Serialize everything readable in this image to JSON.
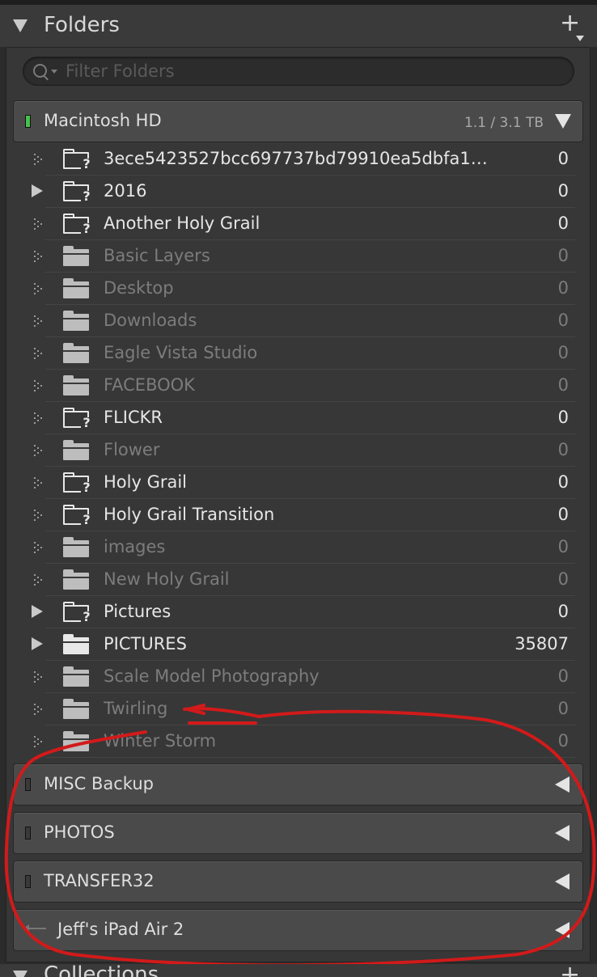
{
  "header": {
    "title": "Folders",
    "add_label": "+"
  },
  "search": {
    "placeholder": "Filter Folders"
  },
  "volumes": [
    {
      "name": "Macintosh HD",
      "size": "1.1 / 3.1 TB",
      "status_color": "#47c14d",
      "expanded": true
    },
    {
      "name": "MISC Backup",
      "status_color": "#3a3a3a",
      "expanded": false
    },
    {
      "name": "PHOTOS",
      "status_color": "#3a3a3a",
      "expanded": false
    },
    {
      "name": "TRANSFER32",
      "status_color": "#3a3a3a",
      "expanded": false
    },
    {
      "name": "Jeff's iPad Air 2",
      "icon": "ipad-sync-icon",
      "expanded": false
    }
  ],
  "folders": [
    {
      "name": "3ece5423527bcc697737bd79910ea5dbfa1a...",
      "count": "0",
      "state": "missing",
      "expand": "dots"
    },
    {
      "name": "2016",
      "count": "0",
      "state": "missing",
      "expand": "tri"
    },
    {
      "name": "Another Holy Grail",
      "count": "0",
      "state": "missing",
      "expand": "dots"
    },
    {
      "name": "Basic Layers",
      "count": "0",
      "state": "dim",
      "expand": "dots"
    },
    {
      "name": "Desktop",
      "count": "0",
      "state": "dim",
      "expand": "dots"
    },
    {
      "name": "Downloads",
      "count": "0",
      "state": "dim",
      "expand": "dots"
    },
    {
      "name": "Eagle Vista Studio",
      "count": "0",
      "state": "dim",
      "expand": "dots"
    },
    {
      "name": "FACEBOOK",
      "count": "0",
      "state": "dim",
      "expand": "dots"
    },
    {
      "name": "FLICKR",
      "count": "0",
      "state": "missing",
      "expand": "dots"
    },
    {
      "name": "Flower",
      "count": "0",
      "state": "dim",
      "expand": "dots"
    },
    {
      "name": "Holy Grail",
      "count": "0",
      "state": "missing",
      "expand": "dots"
    },
    {
      "name": "Holy Grail Transition",
      "count": "0",
      "state": "missing",
      "expand": "dots"
    },
    {
      "name": "images",
      "count": "0",
      "state": "dim",
      "expand": "dots"
    },
    {
      "name": "New Holy Grail",
      "count": "0",
      "state": "dim",
      "expand": "dots"
    },
    {
      "name": "Pictures",
      "count": "0",
      "state": "missing",
      "expand": "tri"
    },
    {
      "name": "PICTURES",
      "count": "35807",
      "state": "active",
      "expand": "tri"
    },
    {
      "name": "Scale Model Photography",
      "count": "0",
      "state": "dim",
      "expand": "dots"
    },
    {
      "name": "Twirling",
      "count": "0",
      "state": "dim",
      "expand": "dots"
    },
    {
      "name": "Winter Storm",
      "count": "0",
      "state": "dim",
      "expand": "dots"
    }
  ],
  "collections": {
    "title": "Collections",
    "add_label": "+"
  },
  "annotation_color": "#d21a1a"
}
